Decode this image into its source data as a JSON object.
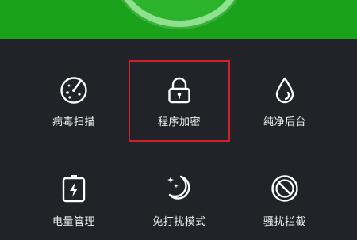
{
  "header": {
    "accent_color": "#1aa31a"
  },
  "highlight_color": "#d21f2a",
  "features": [
    {
      "label": "病毒扫描",
      "icon": "radar-scan-icon"
    },
    {
      "label": "程序加密",
      "icon": "lock-icon"
    },
    {
      "label": "纯净后台",
      "icon": "water-drop-icon"
    },
    {
      "label": "电量管理",
      "icon": "battery-icon"
    },
    {
      "label": "免打扰模式",
      "icon": "moon-stars-icon"
    },
    {
      "label": "骚扰拦截",
      "icon": "block-icon"
    }
  ]
}
